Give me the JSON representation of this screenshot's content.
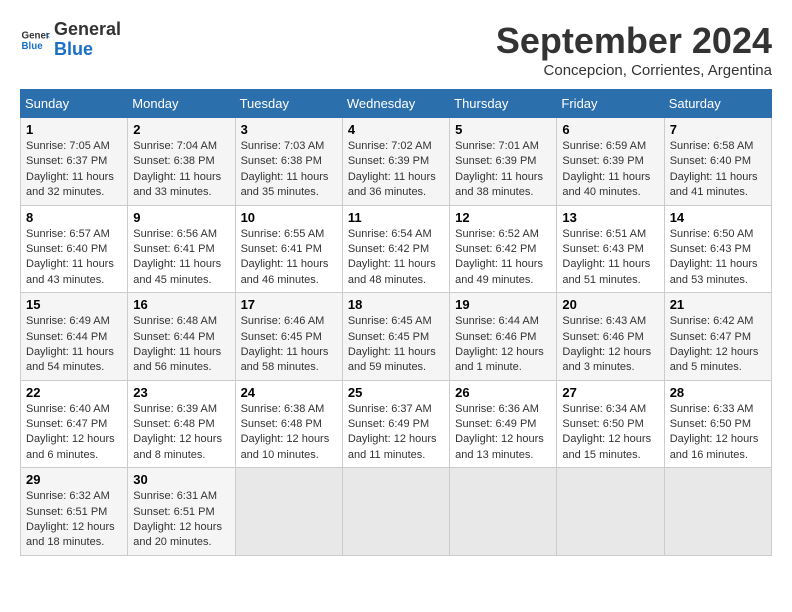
{
  "header": {
    "logo_line1": "General",
    "logo_line2": "Blue",
    "title": "September 2024",
    "subtitle": "Concepcion, Corrientes, Argentina"
  },
  "calendar": {
    "days_of_week": [
      "Sunday",
      "Monday",
      "Tuesday",
      "Wednesday",
      "Thursday",
      "Friday",
      "Saturday"
    ],
    "weeks": [
      [
        {
          "day": "1",
          "info": "Sunrise: 7:05 AM\nSunset: 6:37 PM\nDaylight: 11 hours\nand 32 minutes."
        },
        {
          "day": "2",
          "info": "Sunrise: 7:04 AM\nSunset: 6:38 PM\nDaylight: 11 hours\nand 33 minutes."
        },
        {
          "day": "3",
          "info": "Sunrise: 7:03 AM\nSunset: 6:38 PM\nDaylight: 11 hours\nand 35 minutes."
        },
        {
          "day": "4",
          "info": "Sunrise: 7:02 AM\nSunset: 6:39 PM\nDaylight: 11 hours\nand 36 minutes."
        },
        {
          "day": "5",
          "info": "Sunrise: 7:01 AM\nSunset: 6:39 PM\nDaylight: 11 hours\nand 38 minutes."
        },
        {
          "day": "6",
          "info": "Sunrise: 6:59 AM\nSunset: 6:39 PM\nDaylight: 11 hours\nand 40 minutes."
        },
        {
          "day": "7",
          "info": "Sunrise: 6:58 AM\nSunset: 6:40 PM\nDaylight: 11 hours\nand 41 minutes."
        }
      ],
      [
        {
          "day": "8",
          "info": "Sunrise: 6:57 AM\nSunset: 6:40 PM\nDaylight: 11 hours\nand 43 minutes."
        },
        {
          "day": "9",
          "info": "Sunrise: 6:56 AM\nSunset: 6:41 PM\nDaylight: 11 hours\nand 45 minutes."
        },
        {
          "day": "10",
          "info": "Sunrise: 6:55 AM\nSunset: 6:41 PM\nDaylight: 11 hours\nand 46 minutes."
        },
        {
          "day": "11",
          "info": "Sunrise: 6:54 AM\nSunset: 6:42 PM\nDaylight: 11 hours\nand 48 minutes."
        },
        {
          "day": "12",
          "info": "Sunrise: 6:52 AM\nSunset: 6:42 PM\nDaylight: 11 hours\nand 49 minutes."
        },
        {
          "day": "13",
          "info": "Sunrise: 6:51 AM\nSunset: 6:43 PM\nDaylight: 11 hours\nand 51 minutes."
        },
        {
          "day": "14",
          "info": "Sunrise: 6:50 AM\nSunset: 6:43 PM\nDaylight: 11 hours\nand 53 minutes."
        }
      ],
      [
        {
          "day": "15",
          "info": "Sunrise: 6:49 AM\nSunset: 6:44 PM\nDaylight: 11 hours\nand 54 minutes."
        },
        {
          "day": "16",
          "info": "Sunrise: 6:48 AM\nSunset: 6:44 PM\nDaylight: 11 hours\nand 56 minutes."
        },
        {
          "day": "17",
          "info": "Sunrise: 6:46 AM\nSunset: 6:45 PM\nDaylight: 11 hours\nand 58 minutes."
        },
        {
          "day": "18",
          "info": "Sunrise: 6:45 AM\nSunset: 6:45 PM\nDaylight: 11 hours\nand 59 minutes."
        },
        {
          "day": "19",
          "info": "Sunrise: 6:44 AM\nSunset: 6:46 PM\nDaylight: 12 hours\nand 1 minute."
        },
        {
          "day": "20",
          "info": "Sunrise: 6:43 AM\nSunset: 6:46 PM\nDaylight: 12 hours\nand 3 minutes."
        },
        {
          "day": "21",
          "info": "Sunrise: 6:42 AM\nSunset: 6:47 PM\nDaylight: 12 hours\nand 5 minutes."
        }
      ],
      [
        {
          "day": "22",
          "info": "Sunrise: 6:40 AM\nSunset: 6:47 PM\nDaylight: 12 hours\nand 6 minutes."
        },
        {
          "day": "23",
          "info": "Sunrise: 6:39 AM\nSunset: 6:48 PM\nDaylight: 12 hours\nand 8 minutes."
        },
        {
          "day": "24",
          "info": "Sunrise: 6:38 AM\nSunset: 6:48 PM\nDaylight: 12 hours\nand 10 minutes."
        },
        {
          "day": "25",
          "info": "Sunrise: 6:37 AM\nSunset: 6:49 PM\nDaylight: 12 hours\nand 11 minutes."
        },
        {
          "day": "26",
          "info": "Sunrise: 6:36 AM\nSunset: 6:49 PM\nDaylight: 12 hours\nand 13 minutes."
        },
        {
          "day": "27",
          "info": "Sunrise: 6:34 AM\nSunset: 6:50 PM\nDaylight: 12 hours\nand 15 minutes."
        },
        {
          "day": "28",
          "info": "Sunrise: 6:33 AM\nSunset: 6:50 PM\nDaylight: 12 hours\nand 16 minutes."
        }
      ],
      [
        {
          "day": "29",
          "info": "Sunrise: 6:32 AM\nSunset: 6:51 PM\nDaylight: 12 hours\nand 18 minutes."
        },
        {
          "day": "30",
          "info": "Sunrise: 6:31 AM\nSunset: 6:51 PM\nDaylight: 12 hours\nand 20 minutes."
        },
        {
          "day": "",
          "info": ""
        },
        {
          "day": "",
          "info": ""
        },
        {
          "day": "",
          "info": ""
        },
        {
          "day": "",
          "info": ""
        },
        {
          "day": "",
          "info": ""
        }
      ]
    ]
  }
}
